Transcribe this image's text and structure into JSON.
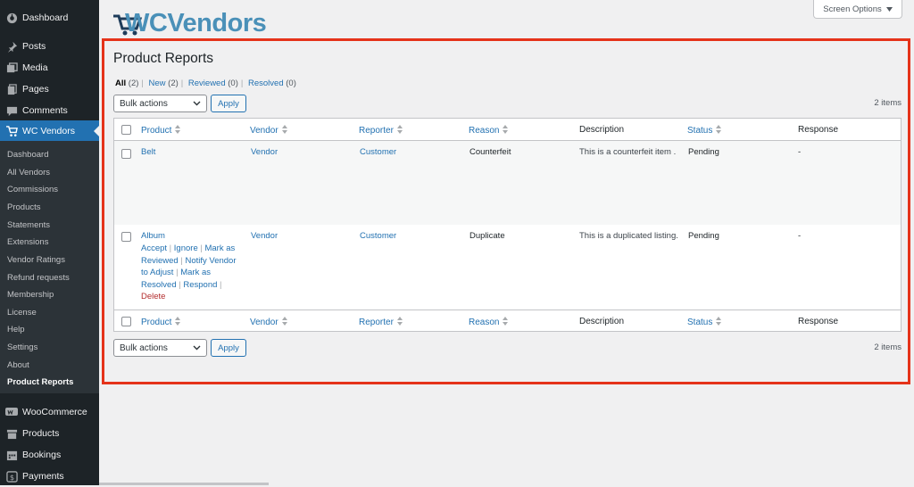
{
  "sidebar": {
    "items": [
      {
        "label": "Dashboard",
        "icon": "dashboard-icon"
      },
      {
        "label": "Posts",
        "icon": "pin-icon"
      },
      {
        "label": "Media",
        "icon": "media-icon"
      },
      {
        "label": "Pages",
        "icon": "pages-icon"
      },
      {
        "label": "Comments",
        "icon": "comment-icon"
      },
      {
        "label": "WC Vendors",
        "icon": "cart-icon",
        "current": true
      }
    ],
    "submenu": [
      "Dashboard",
      "All Vendors",
      "Commissions",
      "Products",
      "Statements",
      "Extensions",
      "Vendor Ratings",
      "Refund requests",
      "Membership",
      "License",
      "Help",
      "Settings",
      "About",
      "Product Reports"
    ],
    "submenu_active": "Product Reports",
    "bottom_items": [
      {
        "label": "WooCommerce",
        "icon": "woocommerce-icon"
      },
      {
        "label": "Products",
        "icon": "archive-icon"
      },
      {
        "label": "Bookings",
        "icon": "calendar-icon"
      },
      {
        "label": "Payments",
        "icon": "dollar-icon"
      }
    ]
  },
  "logo": {
    "text": "WCVendors",
    "color": "#4a90b8"
  },
  "screen_options": {
    "label": "Screen Options"
  },
  "page": {
    "title": "Product Reports",
    "views": {
      "all": "All",
      "all_count": "(2)",
      "new": "New",
      "new_count": "(2)",
      "reviewed": "Reviewed",
      "reviewed_count": "(0)",
      "resolved": "Resolved",
      "resolved_count": "(0)"
    },
    "bulk_actions": "Bulk actions",
    "apply": "Apply",
    "items_count": "2 items"
  },
  "table": {
    "columns": [
      "Product",
      "Vendor",
      "Reporter",
      "Reason",
      "Description",
      "Status",
      "Response"
    ],
    "rows": [
      {
        "product": "Belt",
        "vendor": "Vendor",
        "reporter": "Customer",
        "reason": "Counterfeit",
        "description": "This is a counterfeit item .",
        "status": "Pending",
        "response": "-"
      },
      {
        "product": "Album",
        "vendor": "Vendor",
        "reporter": "Customer",
        "reason": "Duplicate",
        "description": "This is a duplicated listing.",
        "status": "Pending",
        "response": "-",
        "row_actions": {
          "accept": "Accept",
          "ignore": "Ignore",
          "mark_reviewed": "Mark as Reviewed",
          "notify": "Notify Vendor to Adjust",
          "mark_resolved": "Mark as Resolved",
          "respond": "Respond",
          "delete": "Delete"
        }
      }
    ]
  },
  "colors": {
    "accent": "#2271b1",
    "sidebar_bg": "#1d2327",
    "highlight": "#e5331a",
    "delete": "#b32d2e"
  }
}
